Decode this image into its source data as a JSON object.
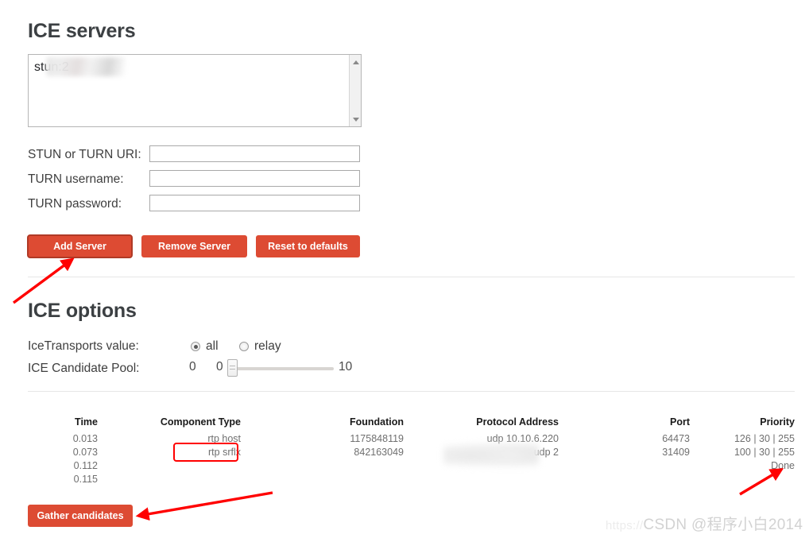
{
  "sections": {
    "ice_servers_title": "ICE servers",
    "ice_options_title": "ICE options"
  },
  "servers_textarea": {
    "value": "stun:2",
    "redacted_note": "remainder of URI blurred"
  },
  "form": {
    "uri_label": "STUN or TURN URI:",
    "uri_value": "",
    "uri_placeholder": "",
    "username_label": "TURN username:",
    "username_value": "",
    "username_placeholder": "",
    "password_label": "TURN password:",
    "password_value": "",
    "password_placeholder": ""
  },
  "buttons": {
    "add_server": "Add Server",
    "remove_server": "Remove Server",
    "reset_defaults": "Reset to defaults",
    "gather_candidates": "Gather candidates",
    "accent_color": "#dd4b33"
  },
  "ice_options": {
    "transports_label": "IceTransports value:",
    "transports_options": [
      "all",
      "relay"
    ],
    "transports_selected": "all",
    "pool_label": "ICE Candidate Pool:",
    "pool_current": "0",
    "pool_min": "0",
    "pool_max": "10"
  },
  "candidates_table": {
    "headers": [
      "Time",
      "Component Type",
      "Foundation",
      "Protocol Address",
      "Port",
      "Priority"
    ],
    "rows": [
      {
        "time": "0.013",
        "component_type": "rtp host",
        "foundation": "1175848119",
        "protocol_address": "udp 10.10.6.220",
        "port": "64473",
        "priority": "126 | 30 | 255"
      },
      {
        "time": "0.073",
        "component_type": "rtp srflx",
        "foundation": "842163049",
        "protocol_address": "udp 2",
        "port": "31409",
        "priority": "100 | 30 | 255"
      },
      {
        "time": "0.112",
        "component_type": "",
        "foundation": "",
        "protocol_address": "",
        "port": "",
        "priority": "Done"
      },
      {
        "time": "0.115",
        "component_type": "",
        "foundation": "",
        "protocol_address": "",
        "port": "",
        "priority": ""
      }
    ]
  },
  "annotations": {
    "highlight_color": "#ff0000",
    "highlight_target": "rtp srflx",
    "arrow_count": 4
  },
  "watermark": {
    "url_prefix": "https://",
    "text": "CSDN @程序小白2014"
  }
}
